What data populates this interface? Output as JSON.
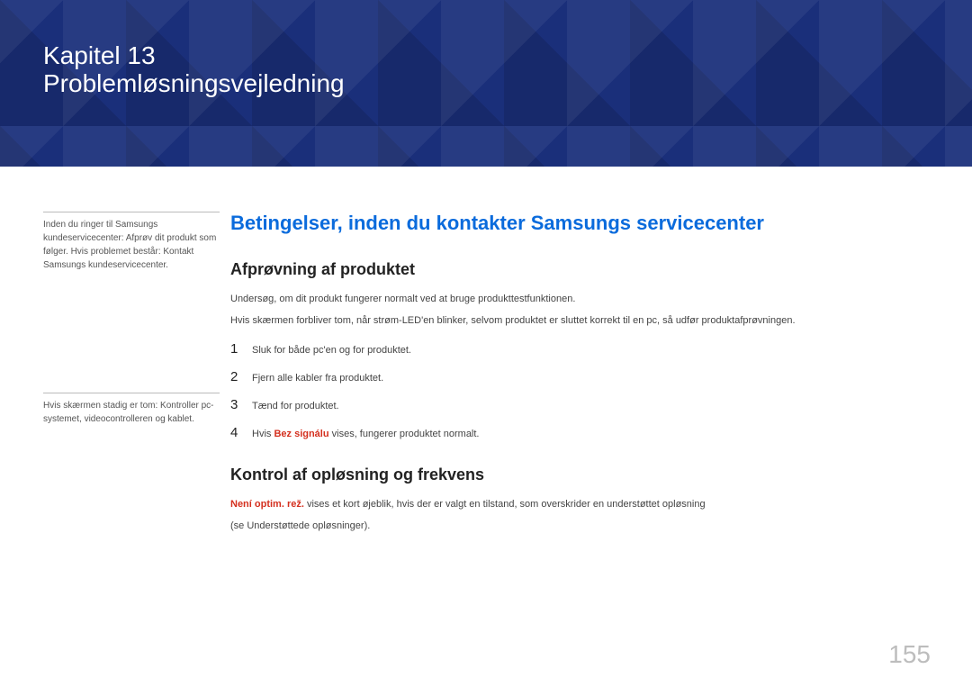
{
  "banner": {
    "chapter_label": "Kapitel  13",
    "chapter_title": "Problemløsningsvejledning"
  },
  "sidebar": {
    "note1": "Inden du ringer til Samsungs kundeservicecenter: Afprøv dit produkt som følger. Hvis problemet består: Kontakt Samsungs kundeservicecenter.",
    "note2": "Hvis skærmen stadig er tom: Kontroller pc-systemet, videocontrolleren og kablet."
  },
  "main": {
    "section_title": "Betingelser, inden du kontakter Samsungs servicecenter",
    "s1": {
      "heading": "Afprøvning af produktet",
      "p1": "Undersøg, om dit produkt fungerer normalt ved at bruge produkttestfunktionen.",
      "p2": "Hvis skærmen forbliver tom, når strøm-LED'en blinker, selvom produktet er sluttet korrekt til en pc, så udfør produktafprøvningen.",
      "steps": [
        {
          "n": "1",
          "t": "Sluk for både pc'en og for produktet."
        },
        {
          "n": "2",
          "t": "Fjern alle kabler fra produktet."
        },
        {
          "n": "3",
          "t": "Tænd for produktet."
        },
        {
          "n": "4",
          "prefix": "Hvis ",
          "hl": "Bez signálu",
          "suffix": " vises, fungerer produktet normalt."
        }
      ]
    },
    "s2": {
      "heading": "Kontrol af opløsning og frekvens",
      "p_hl": "Není optim. rež.",
      "p_rest": " vises et kort øjeblik, hvis der er valgt en tilstand, som overskrider en understøttet opløsning",
      "p2": "(se Understøttede opløsninger)."
    }
  },
  "page_number": "155"
}
